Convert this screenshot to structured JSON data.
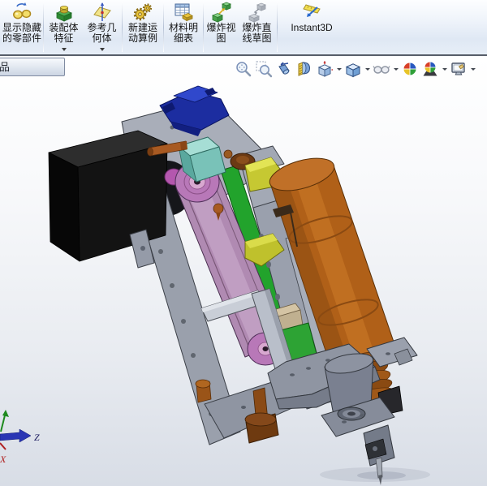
{
  "command_toolbar": {
    "buttons": [
      {
        "id": "show-hide-components",
        "label": "显示隐藏的零部件",
        "has_dropdown": false,
        "enabled": true
      },
      {
        "id": "assembly-features",
        "label": "装配体特征",
        "has_dropdown": true,
        "enabled": true
      },
      {
        "id": "reference-geometry",
        "label": "参考几何体",
        "has_dropdown": true,
        "enabled": true
      },
      {
        "id": "new-motion-study",
        "label": "新建运动算例",
        "has_dropdown": false,
        "enabled": true
      },
      {
        "id": "bill-of-materials",
        "label": "材料明细表",
        "has_dropdown": false,
        "enabled": true
      },
      {
        "id": "exploded-view",
        "label": "爆炸视图",
        "has_dropdown": false,
        "enabled": true
      },
      {
        "id": "explode-line-sketch",
        "label": "爆炸直线草图",
        "has_dropdown": false,
        "enabled": false
      },
      {
        "id": "instant3d",
        "label": "Instant3D",
        "has_dropdown": false,
        "enabled": true
      }
    ]
  },
  "heads_up_toolbar": {
    "items": [
      {
        "id": "zoom-to-fit",
        "has_dropdown": false
      },
      {
        "id": "zoom-to-area",
        "has_dropdown": false
      },
      {
        "id": "previous-view",
        "has_dropdown": false
      },
      {
        "id": "section-view",
        "has_dropdown": false
      },
      {
        "id": "view-orientation",
        "has_dropdown": true
      },
      {
        "id": "display-style",
        "has_dropdown": true
      },
      {
        "id": "hide-show-items",
        "has_dropdown": true
      },
      {
        "id": "edit-appearance",
        "has_dropdown": false
      },
      {
        "id": "apply-scene",
        "has_dropdown": true
      },
      {
        "id": "view-settings",
        "has_dropdown": true
      }
    ]
  },
  "viewport": {
    "document_tab_label": "产品",
    "orientation_triad": {
      "x_label": "X",
      "z_label": "Z",
      "x_color": "#b02020",
      "y_color": "#1e8a1e",
      "z_color": "#2a36b4"
    },
    "background_gradient": {
      "top": "#ffffff",
      "bottom": "#d8dde6"
    },
    "model": {
      "parts": [
        {
          "name": "stepper-motor",
          "color": "#141414"
        },
        {
          "name": "frame-plate",
          "color": "#9aa0ac"
        },
        {
          "name": "drive-belt",
          "color": "#b08ab2"
        },
        {
          "name": "pulley",
          "color": "#b878b8"
        },
        {
          "name": "guide-rail",
          "color": "#22a32c"
        },
        {
          "name": "servo-mount",
          "color": "#1c2da0"
        },
        {
          "name": "coupling-block",
          "color": "#79c2b8"
        },
        {
          "name": "feeder-cylinder",
          "color": "#b06018"
        },
        {
          "name": "sensor-bracket",
          "color": "#c6c832"
        },
        {
          "name": "thumb-screw",
          "color": "#6e3a10"
        },
        {
          "name": "screwdriver-bit",
          "color": "#a4aab4"
        }
      ]
    }
  }
}
